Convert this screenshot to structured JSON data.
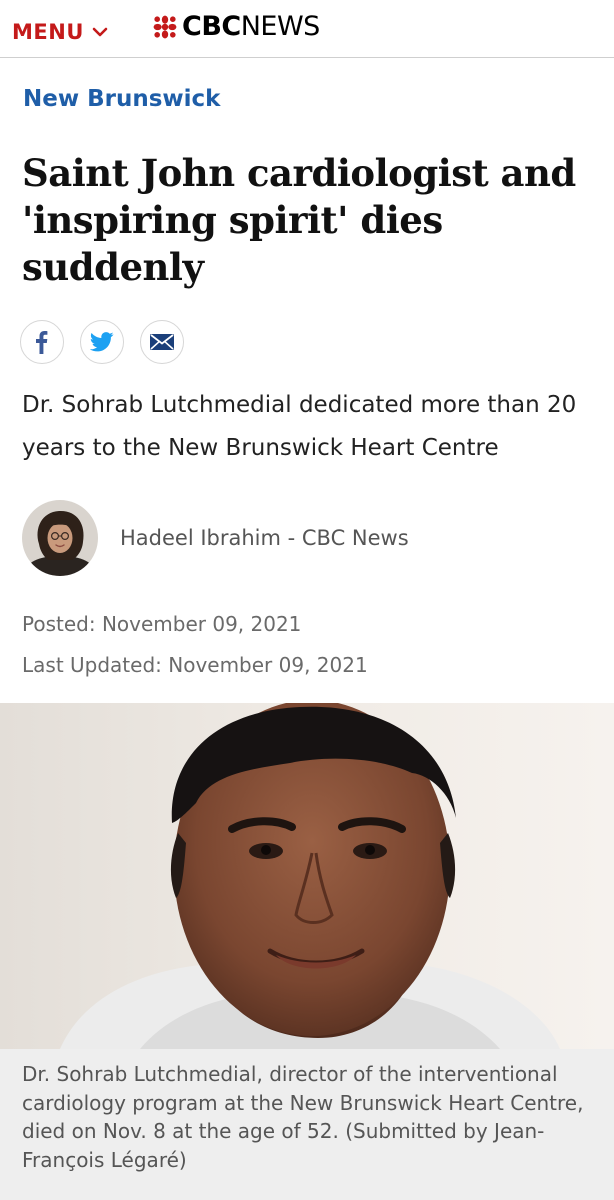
{
  "header": {
    "menu_label": "MENU",
    "logo_brand": "CBC",
    "logo_news": "NEWS"
  },
  "article": {
    "section": "New Brunswick",
    "headline": "Saint John cardiologist and 'inspiring spirit' dies suddenly",
    "deck": "Dr. Sohrab Lutchmedial dedicated more than 20 years to the New Brunswick Heart Centre",
    "author": "Hadeel Ibrahim - CBC News",
    "posted": "Posted: November 09, 2021",
    "updated": "Last Updated: November 09, 2021",
    "caption": "Dr. Sohrab Lutchmedial, director of the interventional cardiology program at the New Brunswick Heart Centre, died on Nov. 8 at the age of 52. (Submitted by  Jean-François Légaré)"
  },
  "share": {
    "icons": [
      "facebook-icon",
      "twitter-icon",
      "email-icon"
    ]
  },
  "colors": {
    "brand_red": "#c41a1a",
    "section_blue": "#1f5ea8",
    "facebook_blue": "#3b5998",
    "twitter_blue": "#1da1f2",
    "email_navy": "#1b3f7a",
    "caption_bg": "#eeeeee"
  }
}
